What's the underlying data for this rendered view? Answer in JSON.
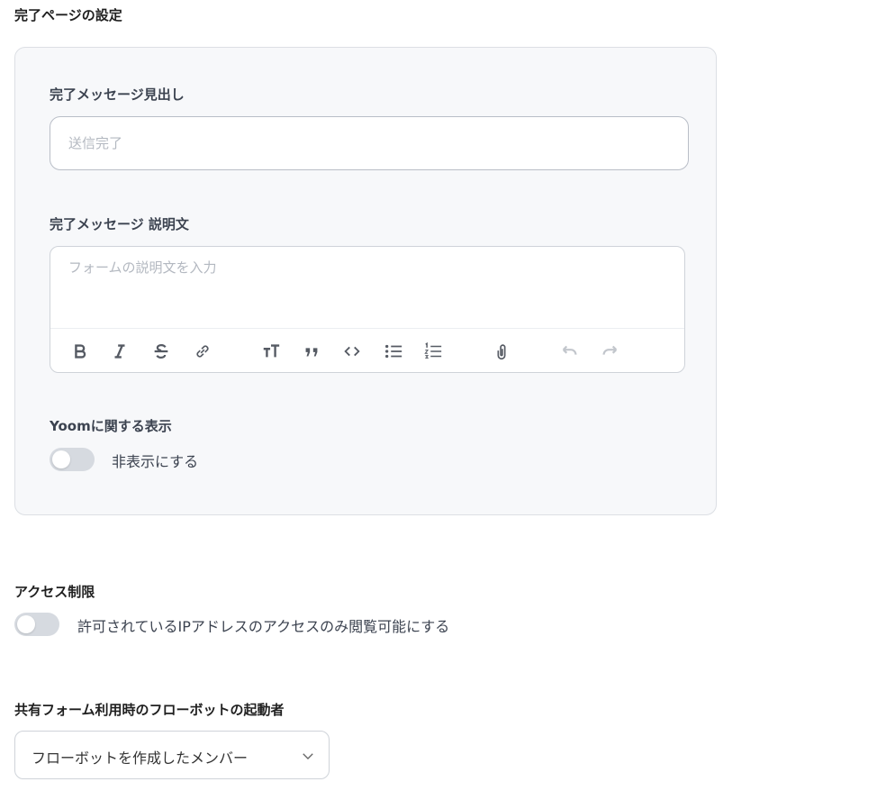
{
  "completion": {
    "section_title": "完了ページの設定",
    "heading_label": "完了メッセージ見出し",
    "heading_placeholder": "送信完了",
    "description_label": "完了メッセージ 説明文",
    "description_placeholder": "フォームの説明文を入力",
    "toolbar_icons": [
      "bold-icon",
      "italic-icon",
      "strikethrough-icon",
      "link-icon",
      "text-size-icon",
      "quote-icon",
      "code-icon",
      "bullet-list-icon",
      "numbered-list-icon",
      "attachment-icon",
      "undo-icon",
      "redo-icon"
    ],
    "yoom_label": "Yoomに関する表示",
    "yoom_toggle_label": "非表示にする"
  },
  "access": {
    "section_title": "アクセス制限",
    "toggle_label": "許可されているIPアドレスのアクセスのみ閲覧可能にする"
  },
  "launcher": {
    "section_title": "共有フォーム利用時のフローボットの起動者",
    "selected": "フローボットを作成したメンバー"
  },
  "colors": {
    "panel_bg": "#f7f8fa",
    "toggle_off": "#d6dae0",
    "text": "#3c4350"
  }
}
